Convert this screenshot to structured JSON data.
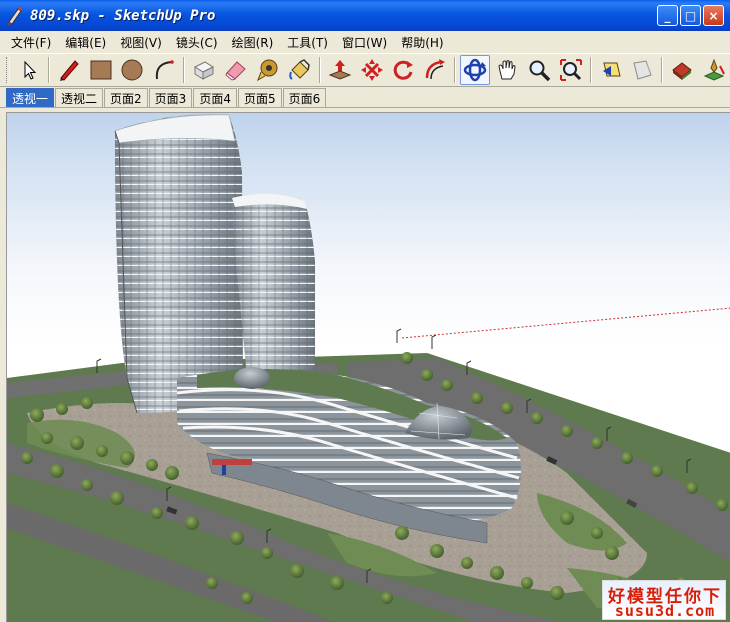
{
  "window": {
    "title": "809.skp - SketchUp Pro",
    "minimize_glyph": "_",
    "maximize_glyph": "□",
    "close_glyph": "×"
  },
  "menu": {
    "items": [
      {
        "label": "文件(F)"
      },
      {
        "label": "编辑(E)"
      },
      {
        "label": "视图(V)"
      },
      {
        "label": "镜头(C)"
      },
      {
        "label": "绘图(R)"
      },
      {
        "label": "工具(T)"
      },
      {
        "label": "窗口(W)"
      },
      {
        "label": "帮助(H)"
      }
    ]
  },
  "toolbar": {
    "tools": [
      {
        "icon": "select-arrow-icon"
      },
      {
        "icon": "pencil-icon"
      },
      {
        "icon": "rectangle-icon"
      },
      {
        "icon": "circle-icon"
      },
      {
        "icon": "arc-icon"
      },
      {
        "icon": "make-component-icon"
      },
      {
        "icon": "eraser-icon"
      },
      {
        "icon": "tape-measure-icon"
      },
      {
        "icon": "paint-bucket-icon"
      },
      {
        "icon": "push-pull-icon"
      },
      {
        "icon": "move-icon"
      },
      {
        "icon": "rotate-icon"
      },
      {
        "icon": "offset-icon"
      },
      {
        "icon": "orbit-icon"
      },
      {
        "icon": "pan-hand-icon"
      },
      {
        "icon": "zoom-icon"
      },
      {
        "icon": "zoom-extents-icon"
      },
      {
        "icon": "previous-view-icon"
      },
      {
        "icon": "next-view-icon"
      },
      {
        "icon": "warehouse-icon"
      },
      {
        "icon": "geo-location-icon"
      }
    ],
    "active_tool": "orbit-icon"
  },
  "scene_tabs": [
    {
      "label": "透视一",
      "active": true
    },
    {
      "label": "透视二",
      "active": false
    },
    {
      "label": "页面2",
      "active": false
    },
    {
      "label": "页面3",
      "active": false
    },
    {
      "label": "页面4",
      "active": false
    },
    {
      "label": "页面5",
      "active": false
    },
    {
      "label": "页面6",
      "active": false
    }
  ],
  "watermark": {
    "line1": "好模型任你下",
    "line2": "susu3d.com"
  },
  "colors": {
    "titlebar": "#0A5FE9",
    "active_tab": "#316AC5",
    "watermark_red": "#D81E06",
    "grass": "#5E7A4E",
    "road": "#6E6E6E",
    "plaza": "#A9A095"
  }
}
